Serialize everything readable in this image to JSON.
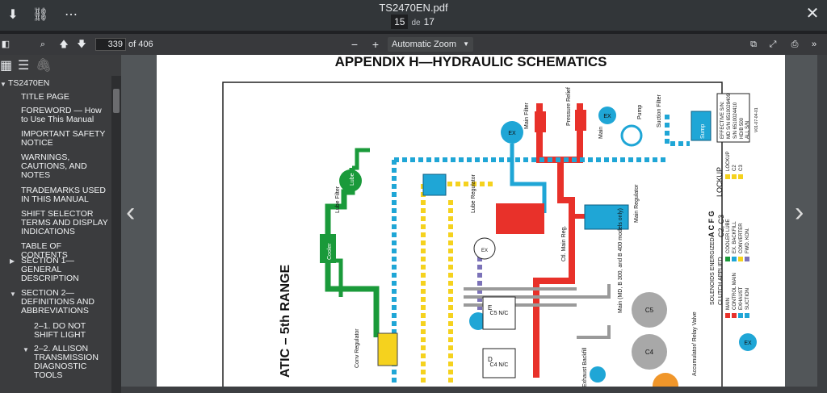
{
  "window": {
    "title": "TS2470EN.pdf",
    "current_page": "15",
    "page_of_word": "de",
    "total_pages": "17",
    "icons": [
      "download-icon",
      "link-icon",
      "more-icon",
      "close-icon"
    ]
  },
  "toolbar": {
    "page_value": "339",
    "page_total": "of 406",
    "zoom_minus": "−",
    "zoom_plus": "+",
    "zoom_label": "Automatic Zoom"
  },
  "sidebar": {
    "root": "TS2470EN",
    "items": [
      {
        "label": "TITLE PAGE"
      },
      {
        "label": "FOREWORD — How to Use This Manual"
      },
      {
        "label": "IMPORTANT SAFETY NOTICE"
      },
      {
        "label": "WARNINGS, CAUTIONS, AND NOTES"
      },
      {
        "label": "TRADEMARKS USED IN THIS MANUAL"
      },
      {
        "label": "SHIFT SELECTOR TERMS AND DISPLAY INDICATIONS"
      },
      {
        "label": "TABLE OF CONTENTS"
      },
      {
        "label": "SECTION 1— GENERAL DESCRIPTION"
      },
      {
        "label": "SECTION 2— DEFINITIONS AND ABBREVIATIONS"
      },
      {
        "label": "2–1. DO NOT SHIFT LIGHT"
      },
      {
        "label": "2–2. ALLISON TRANSMISSION DIAGNOSTIC TOOLS"
      }
    ]
  },
  "document": {
    "heading": "APPENDIX H—HYDRAULIC SCHEMATICS",
    "range_label": "ATIC – 5th RANGE",
    "labels": {
      "main_filter": "Main Filter",
      "pressure_relief": "Pressure Relief",
      "pump": "Pump",
      "suction_filter": "Suction Filter",
      "sump": "Sump",
      "ex": "EX",
      "main": "Main",
      "lube": "Lube",
      "lube_filter": "Lube Filter",
      "lube_regulator": "Lube Regulator",
      "main_regulator": "Main Regulator",
      "cooler": "Cooler",
      "conv_regulator": "Conv Regulator",
      "ctl_main_reg": "Ctl. Main Reg.",
      "main_b300": "Main (MD, B 300, and B 400 models only)",
      "c5": "C5",
      "c4": "C4",
      "c5_nc": "C5 N/C",
      "c4_nc": "C4 N/C",
      "e": "E",
      "d": "D",
      "exhaust_backfill": "Exhaust Backfill",
      "accumulator": "Accumulator/ Relay Valve",
      "effective": [
        "EFFECTIVE S/N:",
        "MD S/N 6510028409",
        "S/N 6510024410",
        "HD/B 500",
        "ALL S/N"
      ],
      "solenoids": "SOLENOIDS ENERGIZED",
      "clutch_applied": "CLUTCH APPLIED",
      "solenoid_letters": "A C F G",
      "clutch_set": "C2, C3",
      "lockup": "LOCKUP",
      "lockup_codes": [
        "LOCKUP",
        "C2",
        "C3"
      ],
      "legend": [
        "COOLER LUBE",
        "EX. BACKFILL",
        "CONVERTER",
        "FWD. KON."
      ],
      "legend2": [
        "MAIN",
        "CONTROL MAIN",
        "EXHAUST",
        "SUCTION"
      ],
      "code": "V01-07-04-01"
    }
  },
  "colors": {
    "red": "#e8312a",
    "blue": "#1fa6d6",
    "green": "#1a9a3a",
    "yellow": "#f5d21e",
    "purple": "#7b72b8",
    "gray": "#9a9a9a"
  }
}
